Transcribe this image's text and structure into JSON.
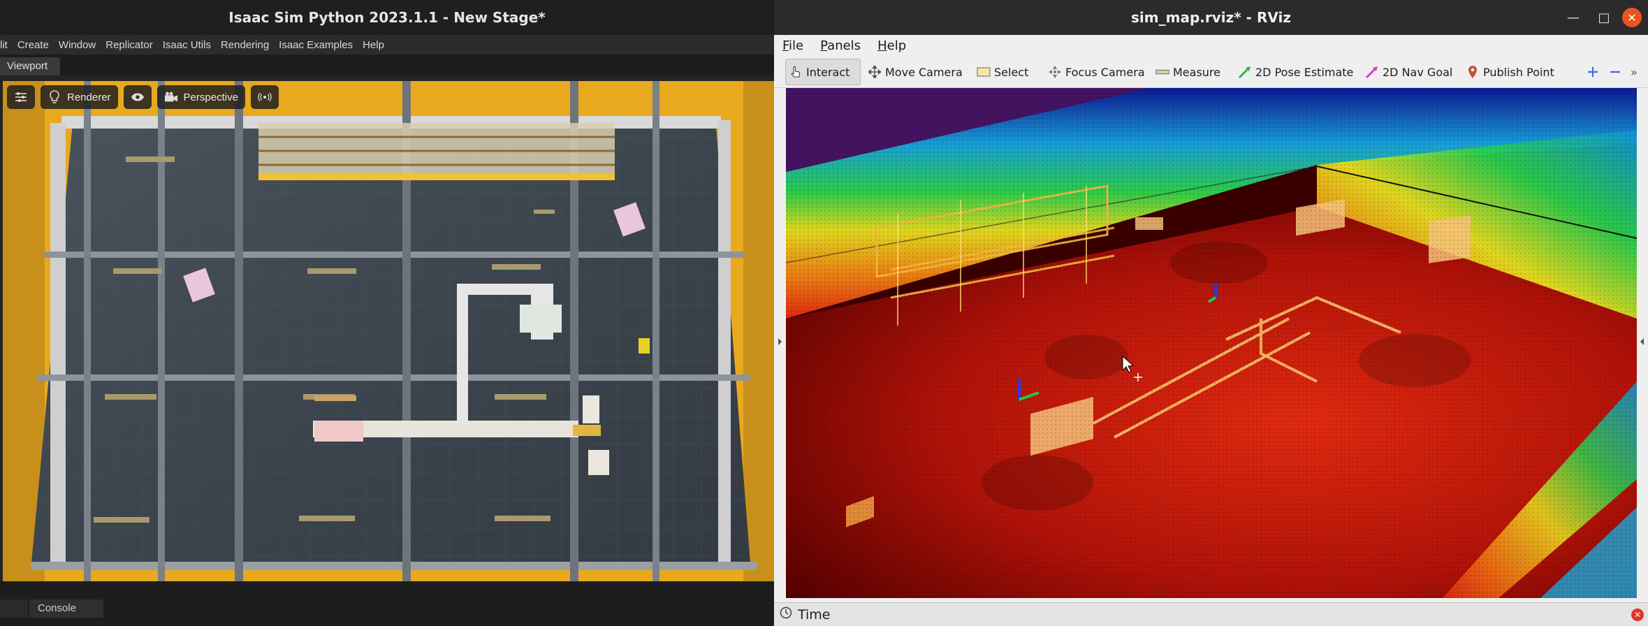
{
  "isaac": {
    "title": "Isaac Sim Python 2023.1.1 - New Stage*",
    "menu": [
      "lit",
      "Create",
      "Window",
      "Replicator",
      "Isaac Utils",
      "Rendering",
      "Isaac Examples",
      "Help"
    ],
    "viewport_tab": "Viewport",
    "viewport_toolbar": {
      "renderer_label": "Renderer",
      "camera_label": "Perspective"
    },
    "bottom_tab": "Console"
  },
  "rviz": {
    "title": "sim_map.rviz* - RViz",
    "menu": {
      "file": "File",
      "panels": "Panels",
      "help": "Help"
    },
    "tools": {
      "interact": "Interact",
      "move_camera": "Move Camera",
      "select": "Select",
      "focus_camera": "Focus Camera",
      "measure": "Measure",
      "pose_estimate": "2D Pose Estimate",
      "nav_goal": "2D Nav Goal",
      "publish_point": "Publish Point"
    },
    "time_panel_label": "Time"
  },
  "colors": {
    "warehouse_yellow": "#f0b323",
    "floor": "#3e4650",
    "rviz_close": "#e95420",
    "pose_estimate": "#3cb043",
    "nav_goal": "#d63cc8"
  }
}
